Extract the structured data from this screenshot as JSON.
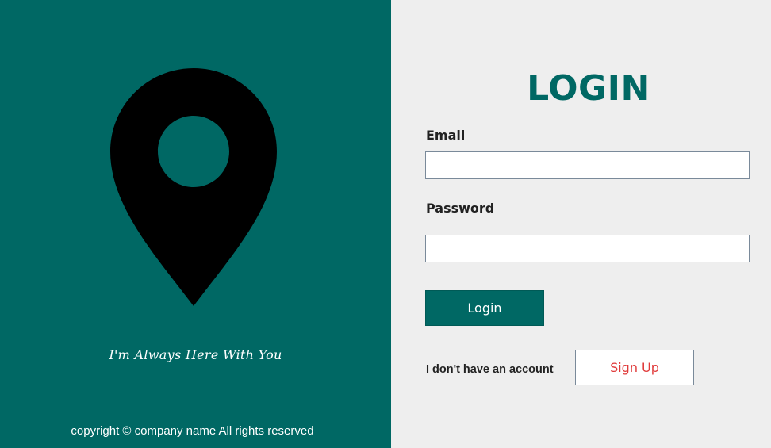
{
  "brand": {
    "tagline": "I'm Always Here With You",
    "copyright": "copyright © company name All rights reserved",
    "logo_icon": "map-pin-icon"
  },
  "login": {
    "title": "LOGIN",
    "email_label": "Email",
    "email_value": "",
    "password_label": "Password",
    "password_value": "",
    "login_button": "Login",
    "no_account_text": "I don't have an account",
    "signup_button": "Sign Up"
  },
  "colors": {
    "primary": "#006864",
    "panel_background": "#eeeeee",
    "signup_text": "#e03a3a",
    "label_text": "#222222"
  }
}
